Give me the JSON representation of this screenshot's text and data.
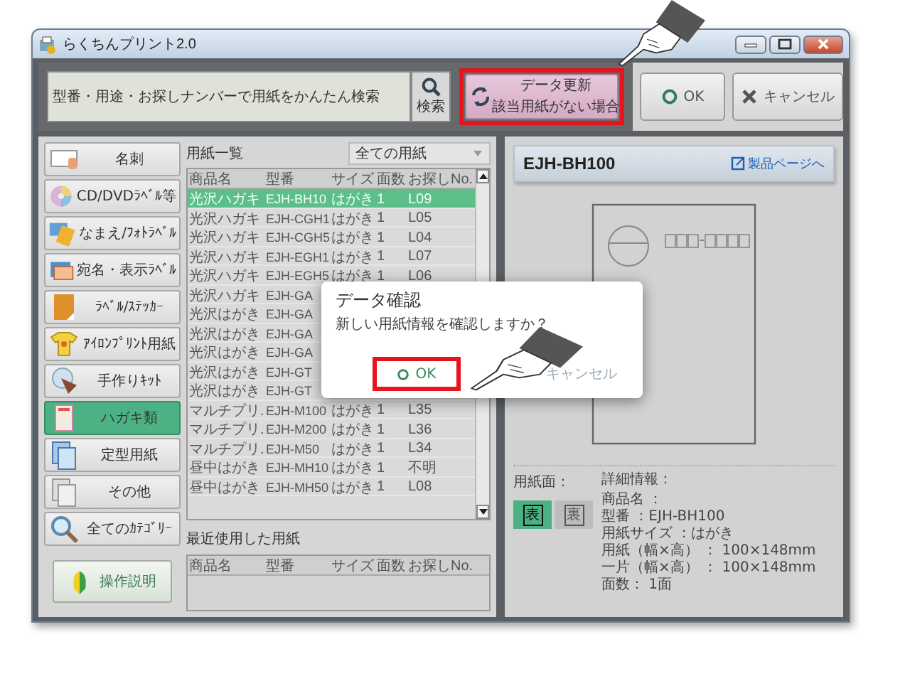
{
  "window": {
    "title": "らくちんプリント2.0"
  },
  "search": {
    "placeholder": "型番・用途・お探しナンバーで用紙をかんたん検索",
    "button": "検索"
  },
  "update_button": {
    "label": "データ更新",
    "sublabel": "該当用紙がない場合",
    "highlighted": true
  },
  "actions": [
    {
      "kind": "ok",
      "label": "OK"
    },
    {
      "kind": "cancel",
      "label": "キャンセル"
    }
  ],
  "sidebar": {
    "items": [
      {
        "label": "名刺",
        "selected": false
      },
      {
        "label": "CD/DVDﾗﾍﾞﾙ等",
        "selected": false
      },
      {
        "label": "なまえ/ﾌｫﾄﾗﾍﾞﾙ",
        "selected": false
      },
      {
        "label": "宛名・表示ﾗﾍﾞﾙ",
        "selected": false
      },
      {
        "label": "ﾗﾍﾞﾙ/ｽﾃｯｶｰ",
        "selected": false
      },
      {
        "label": "ｱｲﾛﾝﾌﾟﾘﾝﾄ用紙",
        "selected": false
      },
      {
        "label": "手作りｷｯﾄ",
        "selected": false
      },
      {
        "label": "ハガキ類",
        "selected": true
      },
      {
        "label": "定型用紙",
        "selected": false
      },
      {
        "label": "その他",
        "selected": false
      },
      {
        "label": "全てのｶﾃｺﾞﾘｰ",
        "selected": false
      }
    ],
    "help_button": "操作説明"
  },
  "paper_list": {
    "title": "用紙一覧",
    "filter": "全ての用紙",
    "columns": [
      "商品名",
      "型番",
      "サイズ",
      "面数",
      "お探しNo."
    ],
    "rows": [
      {
        "cells": [
          "光沢ハガキ",
          "EJH-BH10",
          "はがき",
          "1",
          "L09"
        ],
        "selected": true
      },
      {
        "cells": [
          "光沢ハガキ",
          "EJH-CGH1",
          "はがき",
          "1",
          "L05"
        ],
        "selected": false
      },
      {
        "cells": [
          "光沢ハガキ",
          "EJH-CGH5",
          "はがき",
          "1",
          "L04"
        ],
        "selected": false
      },
      {
        "cells": [
          "光沢ハガキ",
          "EJH-EGH1",
          "はがき",
          "1",
          "L07"
        ],
        "selected": false
      },
      {
        "cells": [
          "光沢ハガキ",
          "EJH-EGH5",
          "はがき",
          "1",
          "L06"
        ],
        "selected": false
      },
      {
        "cells": [
          "光沢ハガキ",
          "EJH-GA"
        ],
        "selected": false
      },
      {
        "cells": [
          "光沢はがき",
          "EJH-GA"
        ],
        "selected": false
      },
      {
        "cells": [
          "光沢はがき",
          "EJH-GA"
        ],
        "selected": false
      },
      {
        "cells": [
          "光沢はがき",
          "EJH-GA"
        ],
        "selected": false
      },
      {
        "cells": [
          "光沢はがき",
          "EJH-GT"
        ],
        "selected": false
      },
      {
        "cells": [
          "光沢はがき",
          "EJH-GT"
        ],
        "selected": false
      },
      {
        "cells": [
          "マルチプリ.",
          "EJH-M100",
          "はがき",
          "1",
          "L35"
        ],
        "selected": false
      },
      {
        "cells": [
          "マルチプリ.",
          "EJH-M200",
          "はがき",
          "1",
          "L36"
        ],
        "selected": false
      },
      {
        "cells": [
          "マルチプリ.",
          "EJH-M50",
          "はがき",
          "1",
          "L34"
        ],
        "selected": false
      },
      {
        "cells": [
          "昼中はがき",
          "EJH-MH10",
          "はがき",
          "1",
          "不明"
        ],
        "selected": false
      },
      {
        "cells": [
          "昼中はがき",
          "EJH-MH50",
          "はがき",
          "1",
          "L08"
        ],
        "selected": false
      }
    ]
  },
  "recent": {
    "title": "最近使用した用紙",
    "columns": [
      "商品名",
      "型番",
      "サイズ",
      "面数",
      "お探しNo."
    ]
  },
  "detail": {
    "model": "EJH-BH100",
    "link": "製品ページへ",
    "side_label": "用紙面：",
    "sides": [
      {
        "label": "表",
        "selected": true
      },
      {
        "label": "裏",
        "selected": false
      }
    ],
    "info_title": "詳細情報：",
    "info_lines": [
      "商品名 ：",
      "型番 ：EJH-BH100",
      "用紙サイズ ：はがき",
      "用紙（幅×高） ： 100×148mm",
      "一片（幅×高） ： 100×148mm",
      "面数： 1面"
    ]
  },
  "dialog": {
    "title": "データ確認",
    "message": "新しい用紙情報を確認しますか？",
    "buttons": [
      {
        "kind": "ok",
        "label": "OK",
        "highlighted": true
      },
      {
        "kind": "cancel",
        "label": "キャンセル",
        "highlighted": false
      }
    ]
  }
}
